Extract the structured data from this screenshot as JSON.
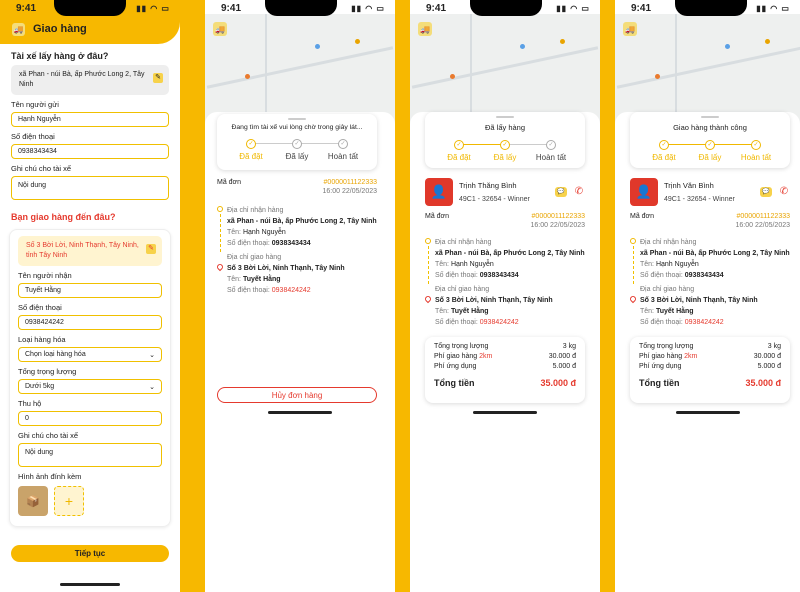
{
  "status_time": "9:41",
  "form": {
    "header_title": "Giao hàng",
    "pickup_question": "Tài xế lấy hàng ở đâu?",
    "pickup_address": "xã Phan - núi Bà, ấp Phước Long 2, Tây Ninh",
    "sender_name_label": "Tên người gửi",
    "sender_name": "Hạnh Nguyễn",
    "phone_label": "Số điện thoại",
    "sender_phone": "0938343434",
    "note_label": "Ghi chú cho tài xế",
    "note_placeholder": "Nội dung",
    "delivery_question": "Bạn giao hàng đến đâu?",
    "delivery_address": "Số 3 Bời Lời, Ninh Thạnh, Tây Ninh, tỉnh Tây Ninh",
    "receiver_name_label": "Tên người nhận",
    "receiver_name": "Tuyết Hằng",
    "receiver_phone_label": "Số điện thoại",
    "receiver_phone": "0938424242",
    "goods_type_label": "Loại hàng hóa",
    "goods_type_placeholder": "Chọn loại hàng hóa",
    "weight_label": "Tổng trọng lượng",
    "weight_value": "Dưới 5kg",
    "cod_label": "Thu hộ",
    "cod_value": "0",
    "note2_label": "Ghi chú cho tài xế",
    "note2_placeholder": "Nội dung",
    "attach_label": "Hình ảnh đính kèm",
    "continue_label": "Tiếp tục"
  },
  "steps": [
    "Đã đặt",
    "Đã lấy",
    "Hoàn tất"
  ],
  "order": {
    "code_label": "Mã đơn",
    "code": "#0000011122333",
    "time": "16:00 22/05/2023",
    "pickup_heading": "Địa chỉ nhận hàng",
    "pickup_address": "xã Phan - núi Bà, ấp Phước Long 2, Tây Ninh",
    "name_label": "Tên:",
    "sender_name": "Hạnh Nguyễn",
    "phone_label": "Số điện thoại:",
    "sender_phone": "0938343434",
    "delivery_heading": "Địa chỉ giao hàng",
    "delivery_address": "Số 3 Bời Lời, Ninh Thạnh, Tây Ninh",
    "receiver_name": "Tuyết Hằng",
    "receiver_phone": "0938424242"
  },
  "searching": {
    "message": "Đang tìm tài xế vui lòng chờ trong giây lát...",
    "cancel_label": "Hủy đơn hàng"
  },
  "picked": {
    "title": "Đã lấy hàng",
    "driver_name": "Trịnh Thăng Bình",
    "driver_plate": "49C1 - 32654 - Winner"
  },
  "done": {
    "title": "Giao hàng thành công",
    "driver_name": "Trịnh Văn Bình",
    "driver_plate": "49C1 - 32654 - Winner"
  },
  "summary": {
    "weight_label": "Tổng trọng lượng",
    "weight": "3 kg",
    "fee_label": "Phí giao hàng",
    "distance": "2km",
    "fee": "30.000 đ",
    "advance_label": "Phí ứng dụng",
    "advance": "5.000 đ",
    "total_label": "Tổng tiền",
    "total": "35.000 đ"
  },
  "colors": {
    "accent": "#f7b800",
    "danger": "#e53a2e"
  },
  "icons": [
    "logo-icon",
    "edit-icon",
    "chevron-down-icon",
    "plus-icon",
    "check-icon",
    "chat-icon",
    "phone-icon",
    "location-pin-icon"
  ]
}
